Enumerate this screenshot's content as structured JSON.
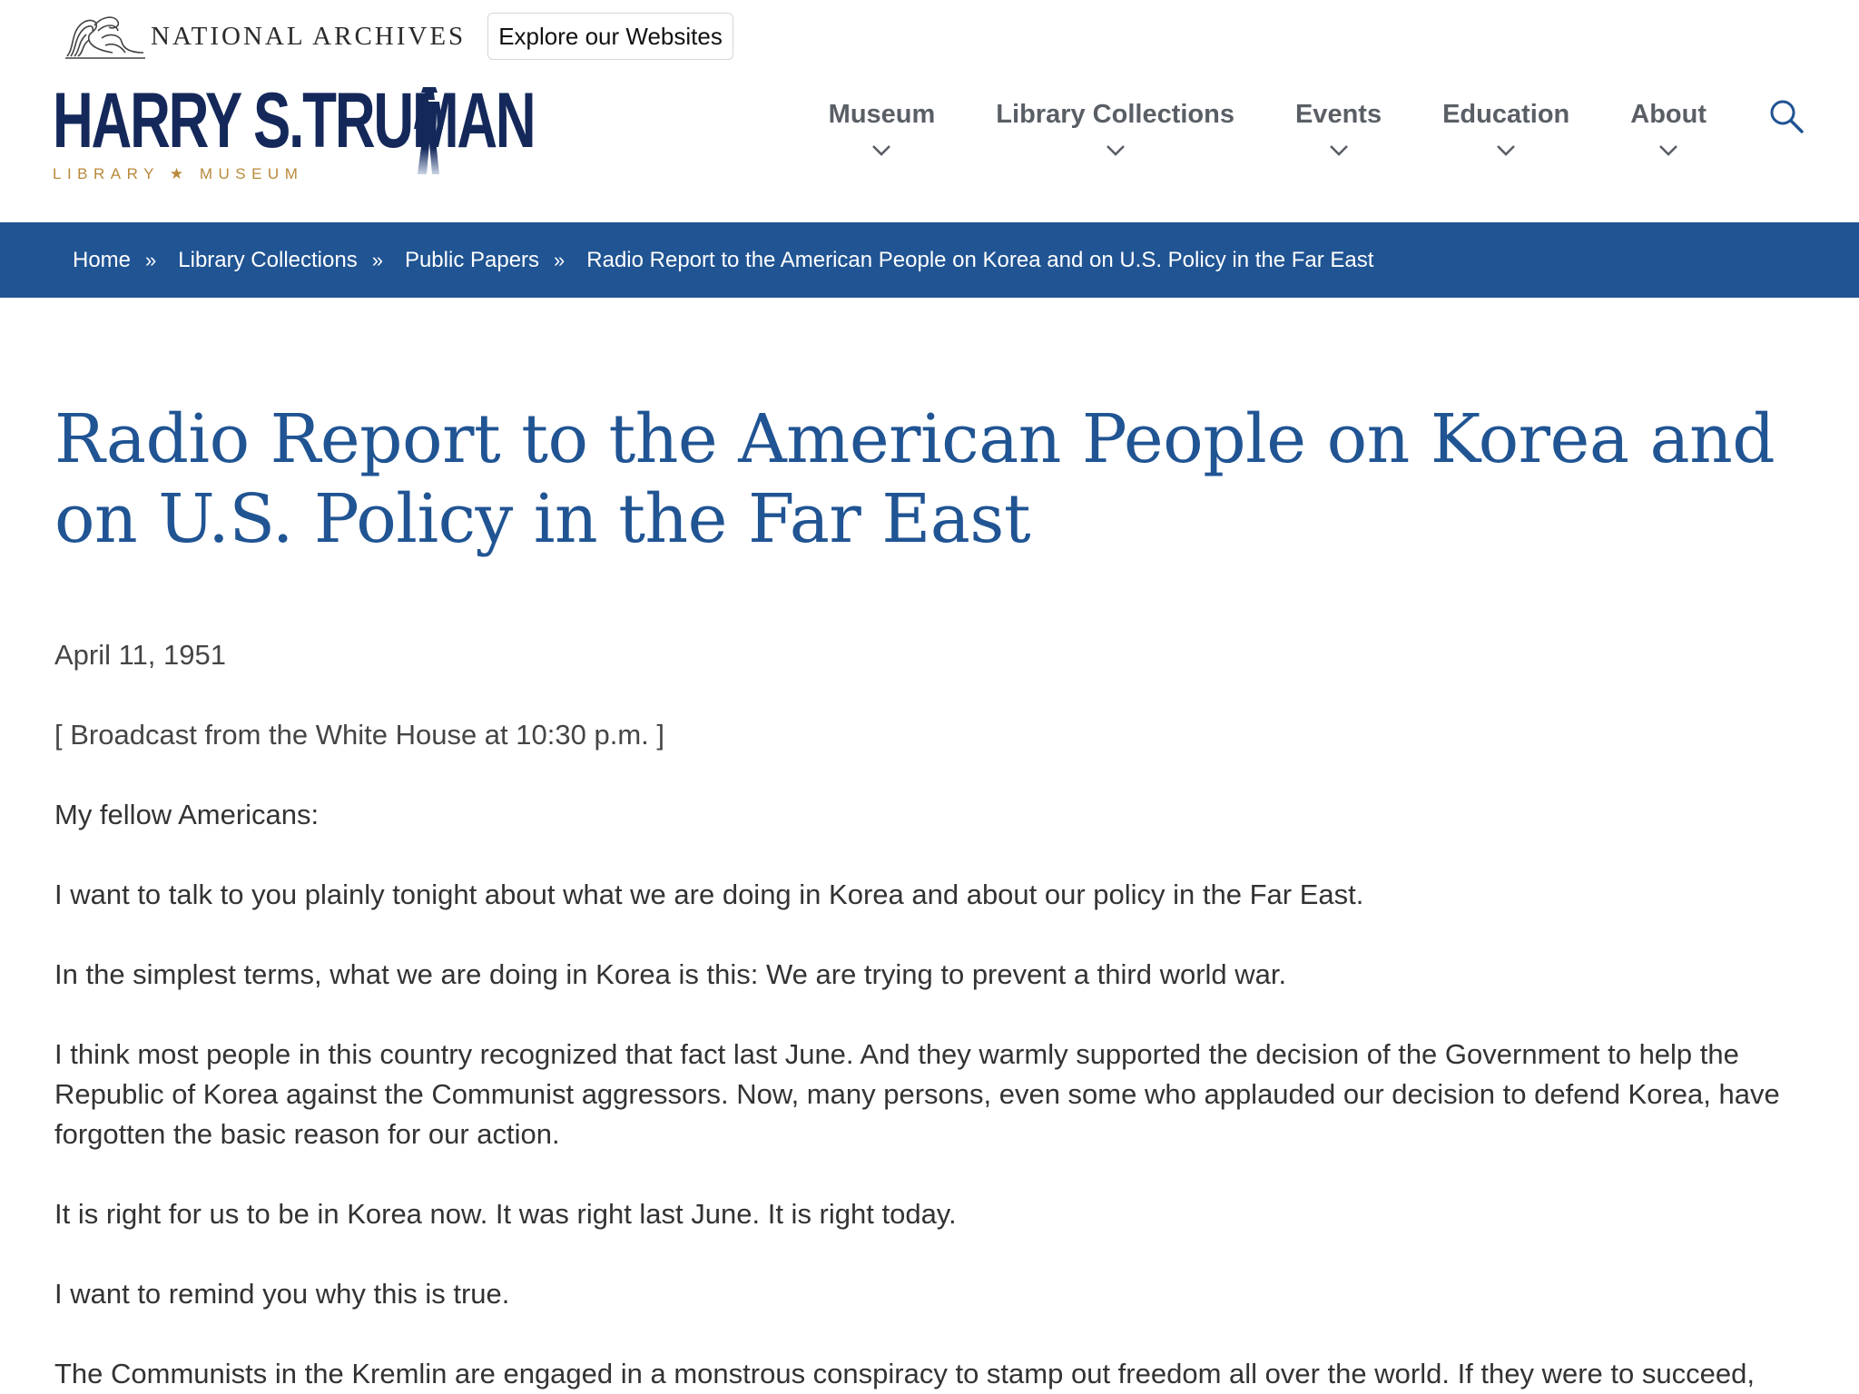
{
  "utility": {
    "agency_name": "NATIONAL ARCHIVES",
    "explore_label": "Explore our Websites"
  },
  "brand": {
    "title": "HARRY S.TRUMAN",
    "subtitle": "LIBRARY ★ MUSEUM"
  },
  "nav": {
    "items": [
      {
        "label": "Museum"
      },
      {
        "label": "Library Collections"
      },
      {
        "label": "Events"
      },
      {
        "label": "Education"
      },
      {
        "label": "About"
      }
    ]
  },
  "breadcrumb": {
    "items": [
      {
        "label": "Home"
      },
      {
        "label": "Library Collections"
      },
      {
        "label": "Public Papers"
      },
      {
        "label": "Radio Report to the American People on Korea and on U.S. Policy in the Far East"
      }
    ],
    "separator": "»"
  },
  "page": {
    "title": "Radio Report to the American People on Korea and on U.S. Policy in the Far East",
    "date": "April 11, 1951",
    "note": "[ Broadcast from the White House at 10:30 p.m. ]",
    "paragraphs": [
      "My fellow Americans:",
      "I want to talk to you plainly tonight about what we are doing in Korea and about our policy in the Far East.",
      "In the simplest terms, what we are doing in Korea is this: We are trying to prevent a third world war.",
      "I think most people in this country recognized that fact last June. And they warmly supported the decision of the Government to help the Republic of Korea against the Communist aggressors. Now, many persons, even some who applauded our decision to defend Korea, have forgotten the basic reason for our action.",
      "It is right for us to be in Korea now. It was right last June. It is right today.",
      "I want to remind you why this is true.",
      "The Communists in the Kremlin are engaged in a monstrous conspiracy to stamp out freedom all over the world. If they were to succeed,"
    ]
  },
  "colors": {
    "primary_blue": "#205493",
    "logo_navy": "#14285a",
    "logo_gold": "#b8893b",
    "nav_gray": "#5a5f66"
  },
  "icons": [
    "national-archives-eagle-icon",
    "truman-figure-icon",
    "chevron-down-icon",
    "search-icon"
  ]
}
